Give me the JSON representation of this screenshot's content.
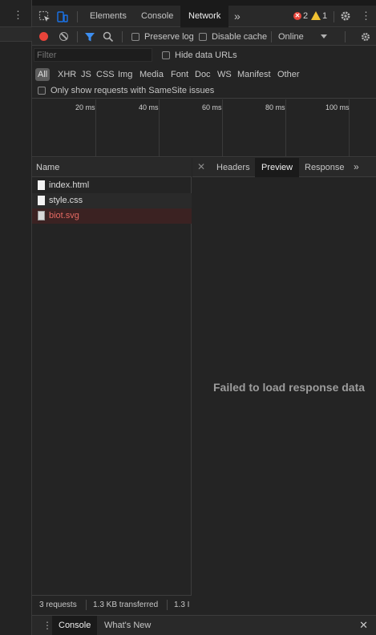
{
  "topbar": {
    "tabs": [
      "Elements",
      "Console",
      "Network"
    ],
    "active_tab": "Network",
    "more_tabs_icon": "chevron-double-right-icon",
    "error_count": "2",
    "warning_count": "1",
    "error_color": "#e8443a",
    "warning_color": "#f1c232"
  },
  "toolbar": {
    "preserve_log": "Preserve log",
    "disable_cache": "Disable cache",
    "throttling": "Online"
  },
  "filter": {
    "placeholder": "Filter",
    "hide_data_urls": "Hide data URLs"
  },
  "types": {
    "items": [
      "All",
      "XHR",
      "JS",
      "CSS",
      "Img",
      "Media",
      "Font",
      "Doc",
      "WS",
      "Manifest",
      "Other"
    ],
    "selected": "All"
  },
  "samesite_label": "Only show requests with SameSite issues",
  "timeline": {
    "ticks": [
      "20 ms",
      "40 ms",
      "60 ms",
      "80 ms",
      "100 ms"
    ]
  },
  "requests": {
    "column_header": "Name",
    "rows": [
      {
        "name": "index.html",
        "failed": false
      },
      {
        "name": "style.css",
        "failed": false
      },
      {
        "name": "biot.svg",
        "failed": true
      }
    ]
  },
  "status": {
    "requests": "3 requests",
    "transferred": "1.3 KB transferred",
    "resources": "1.3 I"
  },
  "detail": {
    "tabs": [
      "Headers",
      "Preview",
      "Response"
    ],
    "active_tab": "Preview",
    "message": "Failed to load response data"
  },
  "drawer": {
    "tabs": [
      "Console",
      "What's New"
    ],
    "active_tab": "Console"
  }
}
